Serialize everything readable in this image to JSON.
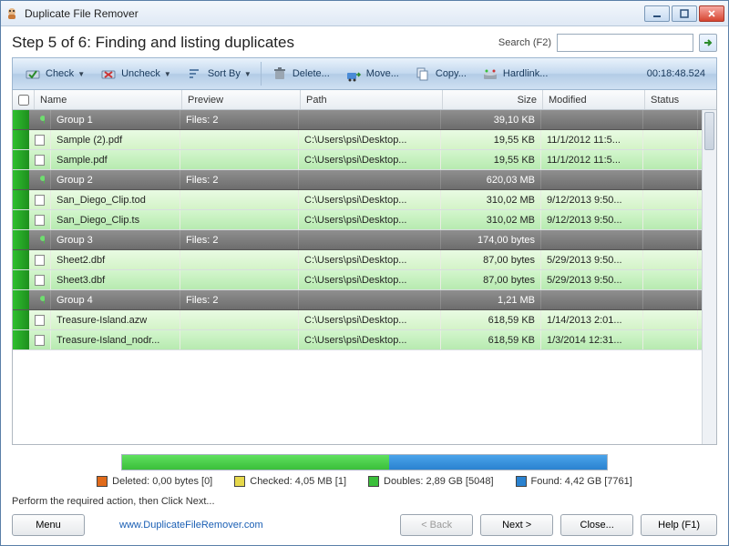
{
  "window": {
    "title": "Duplicate File Remover"
  },
  "step": {
    "title": "Step 5 of 6: Finding and listing duplicates"
  },
  "search": {
    "label": "Search (F2)",
    "value": ""
  },
  "toolbar": {
    "check": "Check",
    "uncheck": "Uncheck",
    "sortby": "Sort By",
    "delete": "Delete...",
    "move": "Move...",
    "copy": "Copy...",
    "hardlink": "Hardlink...",
    "time": "00:18:48.524"
  },
  "columns": {
    "name": "Name",
    "preview": "Preview",
    "path": "Path",
    "size": "Size",
    "modified": "Modified",
    "status": "Status"
  },
  "groups": [
    {
      "label": "Group 1",
      "files_label": "Files: 2",
      "size": "39,10 KB",
      "files": [
        {
          "name": "Sample (2).pdf",
          "path": "C:\\Users\\psi\\Desktop...",
          "size": "19,55 KB",
          "modified": "11/1/2012 11:5..."
        },
        {
          "name": "Sample.pdf",
          "path": "C:\\Users\\psi\\Desktop...",
          "size": "19,55 KB",
          "modified": "11/1/2012 11:5..."
        }
      ]
    },
    {
      "label": "Group 2",
      "files_label": "Files: 2",
      "size": "620,03 MB",
      "files": [
        {
          "name": "San_Diego_Clip.tod",
          "path": "C:\\Users\\psi\\Desktop...",
          "size": "310,02 MB",
          "modified": "9/12/2013 9:50..."
        },
        {
          "name": "San_Diego_Clip.ts",
          "path": "C:\\Users\\psi\\Desktop...",
          "size": "310,02 MB",
          "modified": "9/12/2013 9:50..."
        }
      ]
    },
    {
      "label": "Group 3",
      "files_label": "Files: 2",
      "size": "174,00 bytes",
      "files": [
        {
          "name": "Sheet2.dbf",
          "path": "C:\\Users\\psi\\Desktop...",
          "size": "87,00 bytes",
          "modified": "5/29/2013 9:50..."
        },
        {
          "name": "Sheet3.dbf",
          "path": "C:\\Users\\psi\\Desktop...",
          "size": "87,00 bytes",
          "modified": "5/29/2013 9:50..."
        }
      ]
    },
    {
      "label": "Group 4",
      "files_label": "Files: 2",
      "size": "1,21 MB",
      "files": [
        {
          "name": "Treasure-Island.azw",
          "path": "C:\\Users\\psi\\Desktop...",
          "size": "618,59 KB",
          "modified": "1/14/2013 2:01..."
        },
        {
          "name": "Treasure-Island_nodr...",
          "path": "C:\\Users\\psi\\Desktop...",
          "size": "618,59 KB",
          "modified": "1/3/2014 12:31..."
        }
      ]
    }
  ],
  "progress": {
    "green_pct": 55,
    "blue_pct": 45
  },
  "legend": {
    "deleted": {
      "label": "Deleted: 0,00 bytes [0]",
      "color": "#e06a1a"
    },
    "checked": {
      "label": "Checked: 4,05 MB [1]",
      "color": "#e6d84b"
    },
    "doubles": {
      "label": "Doubles: 2,89 GB [5048]",
      "color": "#3abf3a"
    },
    "found": {
      "label": "Found: 4,42 GB [7761]",
      "color": "#2a82d0"
    }
  },
  "hint": "Perform the required action, then Click Next...",
  "footer": {
    "menu": "Menu",
    "link": "www.DuplicateFileRemover.com",
    "back": "< Back",
    "next": "Next >",
    "close": "Close...",
    "help": "Help (F1)"
  }
}
